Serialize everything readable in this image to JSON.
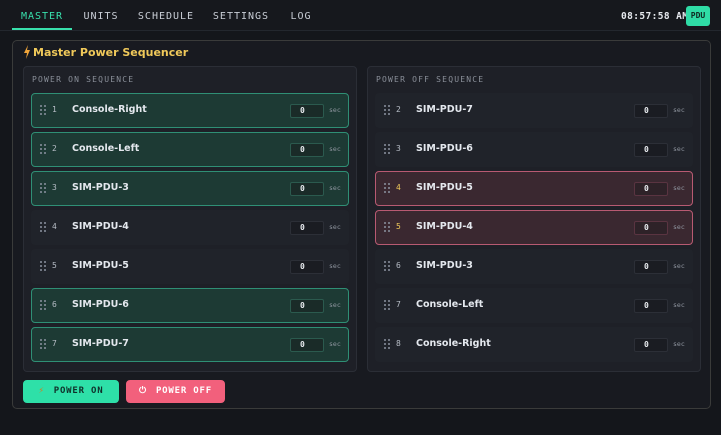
{
  "nav": {
    "tabs": [
      {
        "label": "MASTER",
        "active": true
      },
      {
        "label": "UNITS"
      },
      {
        "label": "SCHEDULE"
      },
      {
        "label": "SETTINGS"
      },
      {
        "label": "LOG"
      }
    ],
    "clock": "08:57:58 AM",
    "badge": "PDU"
  },
  "panel": {
    "title": "Master Power Sequencer",
    "icon": "bolt-icon"
  },
  "power_on": {
    "heading": "POWER ON SEQUENCE",
    "unit_label": "sec",
    "items": [
      {
        "num": "1",
        "name": "Console-Right",
        "delay": "0",
        "state": "on"
      },
      {
        "num": "2",
        "name": "Console-Left",
        "delay": "0",
        "state": "on"
      },
      {
        "num": "3",
        "name": "SIM-PDU-3",
        "delay": "0",
        "state": "on"
      },
      {
        "num": "4",
        "name": "SIM-PDU-4",
        "delay": "0",
        "state": "idle"
      },
      {
        "num": "5",
        "name": "SIM-PDU-5",
        "delay": "0",
        "state": "idle"
      },
      {
        "num": "6",
        "name": "SIM-PDU-6",
        "delay": "0",
        "state": "on"
      },
      {
        "num": "7",
        "name": "SIM-PDU-7",
        "delay": "0",
        "state": "on"
      }
    ]
  },
  "power_off": {
    "heading": "POWER OFF SEQUENCE",
    "unit_label": "sec",
    "items": [
      {
        "num": "2",
        "name": "SIM-PDU-7",
        "delay": "0",
        "state": "idle"
      },
      {
        "num": "3",
        "name": "SIM-PDU-6",
        "delay": "0",
        "state": "idle"
      },
      {
        "num": "4",
        "name": "SIM-PDU-5",
        "delay": "0",
        "state": "off"
      },
      {
        "num": "5",
        "name": "SIM-PDU-4",
        "delay": "0",
        "state": "off"
      },
      {
        "num": "6",
        "name": "SIM-PDU-3",
        "delay": "0",
        "state": "idle"
      },
      {
        "num": "7",
        "name": "Console-Left",
        "delay": "0",
        "state": "idle"
      },
      {
        "num": "8",
        "name": "Console-Right",
        "delay": "0",
        "state": "idle"
      }
    ]
  },
  "actions": {
    "power_on_label": "POWER ON",
    "power_off_label": "POWER OFF"
  },
  "colors": {
    "accent": "#2ee0a8",
    "warning": "#f0c95a",
    "danger": "#f2607c"
  }
}
